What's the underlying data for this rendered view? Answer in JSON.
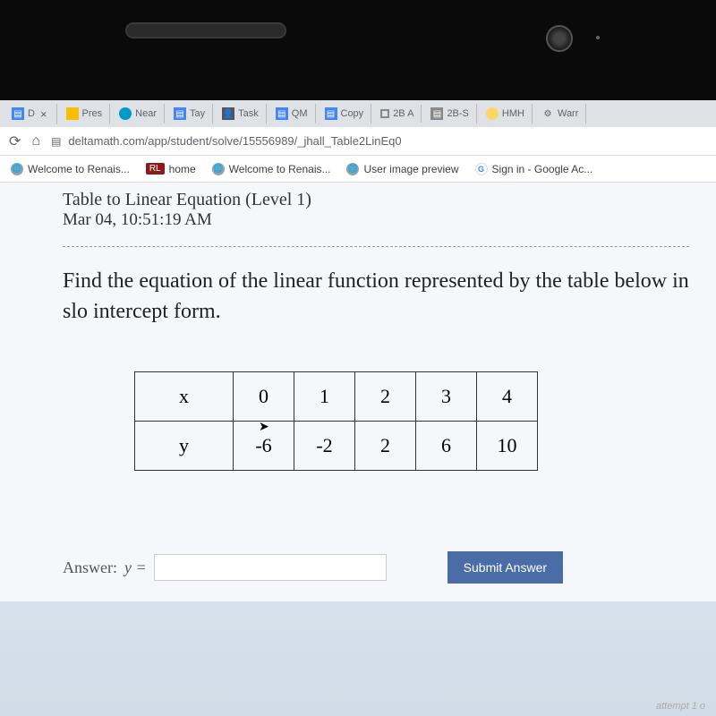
{
  "tabs": [
    {
      "label": "D",
      "close": "×"
    },
    {
      "label": "Pres"
    },
    {
      "label": "Near"
    },
    {
      "label": "Tay"
    },
    {
      "label": "Task"
    },
    {
      "label": "QM"
    },
    {
      "label": "Copy"
    },
    {
      "label": "2B A"
    },
    {
      "label": "2B-S"
    },
    {
      "label": "HMH"
    },
    {
      "label": "Warr"
    }
  ],
  "url": "deltamath.com/app/student/solve/15556989/_jhall_Table2LinEq0",
  "bookmarks": [
    {
      "label": "Welcome to Renais..."
    },
    {
      "badge": "RL",
      "label": "home"
    },
    {
      "label": "Welcome to Renais..."
    },
    {
      "label": "User image preview"
    },
    {
      "label": "Sign in - Google Ac..."
    }
  ],
  "lesson": {
    "title": "Table to Linear Equation (Level 1)",
    "timestamp": "Mar 04, 10:51:19 AM"
  },
  "question": "Find the equation of the linear function represented by the table below in slo intercept form.",
  "table": {
    "row1_header": "x",
    "row1": [
      "0",
      "1",
      "2",
      "3",
      "4"
    ],
    "row2_header": "y",
    "row2": [
      "-6",
      "-2",
      "2",
      "6",
      "10"
    ]
  },
  "answer": {
    "label": "Answer:",
    "prefix": "y =",
    "value": "",
    "submit": "Submit Answer"
  },
  "footer": "attempt 1 o",
  "chart_data": {
    "type": "table",
    "title": "Linear function data",
    "columns": [
      "x",
      "y"
    ],
    "rows": [
      [
        0,
        -6
      ],
      [
        1,
        -2
      ],
      [
        2,
        2
      ],
      [
        3,
        6
      ],
      [
        4,
        10
      ]
    ]
  }
}
